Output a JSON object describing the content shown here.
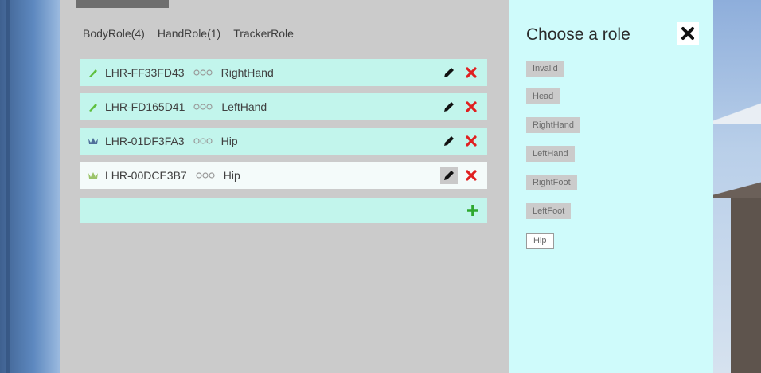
{
  "tabs": {
    "body": "BodyRole(4)",
    "hand": "HandRole(1)",
    "tracker": "TrackerRole"
  },
  "devices": [
    {
      "serial": "LHR-FF33FD43",
      "role": "RightHand",
      "icon": "controller-icon",
      "icon_color": "#5fbf3f"
    },
    {
      "serial": "LHR-FD165D41",
      "role": "LeftHand",
      "icon": "controller-icon",
      "icon_color": "#5fbf3f"
    },
    {
      "serial": "LHR-01DF3FA3",
      "role": "Hip",
      "icon": "tracker-icon",
      "icon_color": "#4f6f9a"
    },
    {
      "serial": "LHR-00DCE3B7",
      "role": "Hip",
      "icon": "tracker-icon",
      "icon_color": "#9cc46a",
      "selected": true
    }
  ],
  "role_panel": {
    "title": "Choose a role",
    "options": [
      "Invalid",
      "Head",
      "RightHand",
      "LeftHand",
      "RightFoot",
      "LeftFoot",
      "Hip"
    ],
    "active": "Hip"
  },
  "colors": {
    "row_bg": "#c2f5ec",
    "panel_bg": "#cbcbcb",
    "chooser_bg": "#cffbfb",
    "delete_red": "#e02020",
    "add_green": "#2ea82e"
  }
}
